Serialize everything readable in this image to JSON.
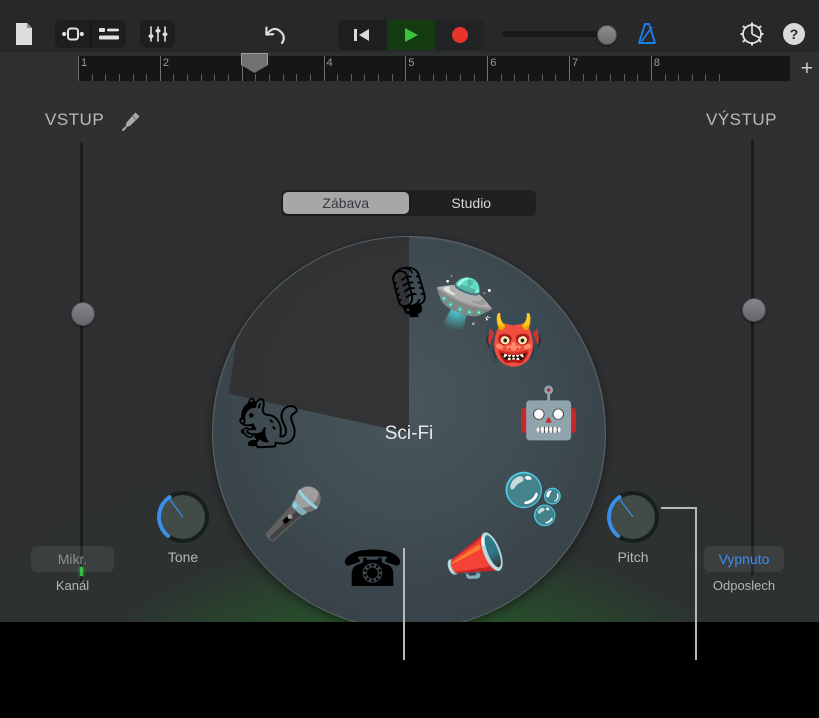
{
  "toolbar": {
    "file_icon": "document-icon",
    "loops_icon": "loop-browser-icon",
    "tracks_icon": "track-list-icon",
    "mixer_icon": "mixer-settings-icon",
    "undo_icon": "undo-icon",
    "rewind_icon": "rewind-icon",
    "play_icon": "play-icon",
    "record_icon": "record-icon",
    "metronome_icon": "metronome-icon",
    "settings_icon": "gear-icon",
    "help_icon": "help-icon",
    "play_color": "#3cc23c",
    "record_color": "#e8342a",
    "metronome_color": "#1a7fe8",
    "volume_value": 85
  },
  "ruler": {
    "bars": [
      "1",
      "2",
      "3",
      "4",
      "5",
      "6",
      "7",
      "8"
    ],
    "playhead_bar": "2.7",
    "add_section_label": "+"
  },
  "input": {
    "label": "VSTUP",
    "plug_icon": "audio-plug-icon",
    "fader_value": 62
  },
  "output": {
    "label": "VÝSTUP",
    "fader_value": 66
  },
  "tabs": {
    "items": [
      {
        "label": "Zábava",
        "active": true
      },
      {
        "label": "Studio",
        "active": false
      }
    ]
  },
  "wheel": {
    "center_label": "Sci-Fi",
    "selected_index": 0,
    "items": [
      {
        "name": "ufo-alien-effect",
        "icon": "🛸",
        "angle": -67,
        "selected": true
      },
      {
        "name": "classic-mic-effect",
        "icon": "🎙",
        "angle": -90,
        "selected": false
      },
      {
        "name": "monster-effect",
        "icon": "👹",
        "angle": -42,
        "selected": false
      },
      {
        "name": "robot-effect",
        "icon": "🤖",
        "angle": -8,
        "selected": false
      },
      {
        "name": "bubbles-effect",
        "icon": "🫧",
        "angle": 28,
        "selected": false
      },
      {
        "name": "megaphone-effect",
        "icon": "📣",
        "angle": 62,
        "selected": false
      },
      {
        "name": "telephone-effect",
        "icon": "☎",
        "angle": 105,
        "selected": false
      },
      {
        "name": "gold-mic-effect",
        "icon": "🎤",
        "angle": 145,
        "selected": false
      },
      {
        "name": "chipmunk-effect",
        "icon": "🐿",
        "angle": 184,
        "selected": false
      }
    ]
  },
  "controls": {
    "tone_label": "Tone",
    "tone_value": 22,
    "pitch_label": "Pitch",
    "pitch_value": 22,
    "channel_button": "Mikr.",
    "channel_caption": "Kanál",
    "monitor_button": "Vypnuto",
    "monitor_caption": "Odposlech",
    "accent_color": "#3a8eea"
  }
}
